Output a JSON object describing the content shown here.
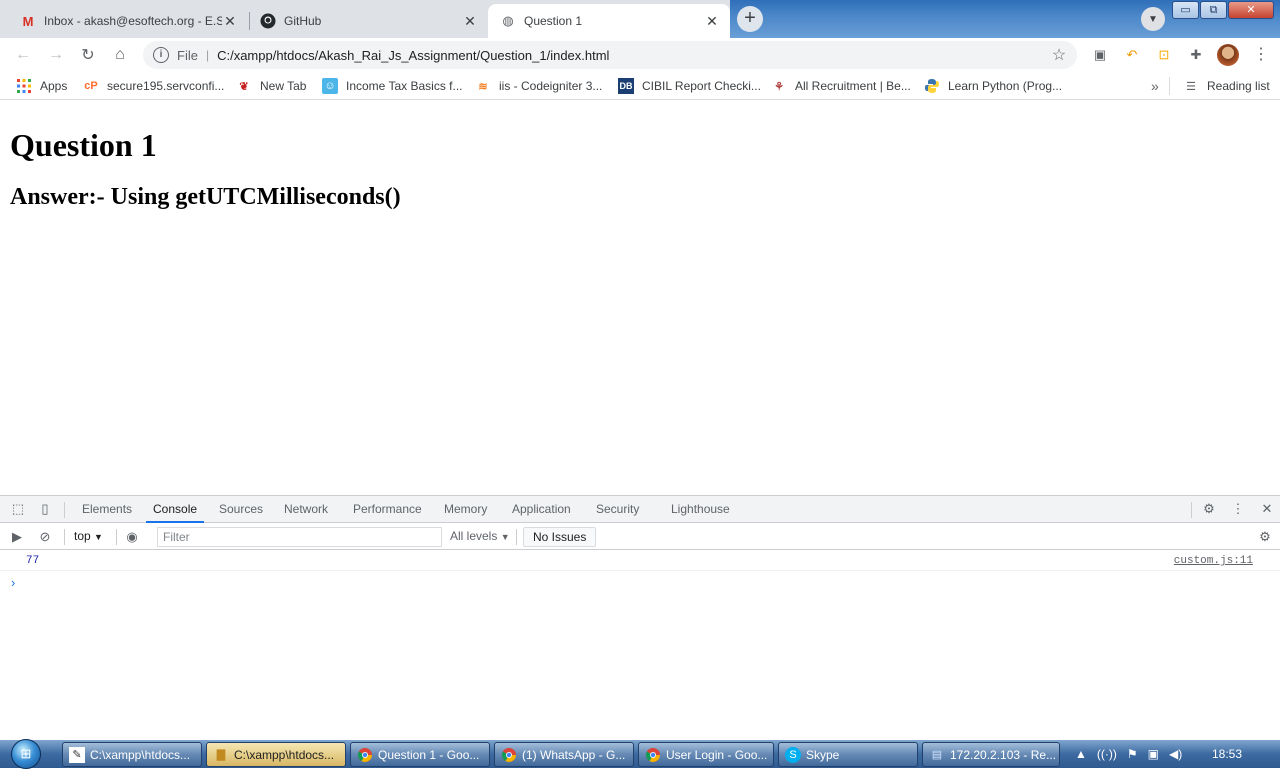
{
  "browser": {
    "tabs": [
      {
        "title": "Inbox - akash@esoftech.org - E.S",
        "icon": "gmail-icon"
      },
      {
        "title": "GitHub",
        "icon": "github-icon"
      },
      {
        "title": "Question 1",
        "icon": "globe-icon"
      }
    ],
    "window_controls": {
      "minimize": "▭",
      "restore": "⧉",
      "close": "✕"
    },
    "address": {
      "scheme_label": "File",
      "url": "C:/xampp/htdocs/Akash_Rai_Js_Assignment/Question_1/index.html"
    },
    "bookmarks": [
      {
        "label": "Apps",
        "icon": "apps-grid-icon"
      },
      {
        "label": "secure195.servconfi...",
        "icon": "cpanel-icon"
      },
      {
        "label": "New Tab",
        "icon": "newtab-icon"
      },
      {
        "label": "Income Tax Basics f...",
        "icon": "robot-icon"
      },
      {
        "label": "iis - Codeigniter 3...",
        "icon": "stackoverflow-icon"
      },
      {
        "label": "CIBIL Report Checki...",
        "icon": "db-icon"
      },
      {
        "label": "All Recruitment | Be...",
        "icon": "recruitment-icon"
      },
      {
        "label": "Learn Python (Prog...",
        "icon": "python-icon"
      }
    ],
    "reading_list": "Reading list"
  },
  "page": {
    "heading": "Question 1",
    "answer": "Answer:- Using getUTCMilliseconds()"
  },
  "devtools": {
    "tabs": [
      "Elements",
      "Console",
      "Sources",
      "Network",
      "Performance",
      "Memory",
      "Application",
      "Security",
      "Lighthouse"
    ],
    "active_tab": "Console",
    "context": "top",
    "filter_placeholder": "Filter",
    "levels": "All levels",
    "issues": "No Issues",
    "log": [
      {
        "value": "77",
        "source": "custom.js:11"
      }
    ]
  },
  "taskbar": {
    "items": [
      {
        "label": "C:\\xampp\\htdocs...",
        "icon": "notepad-icon"
      },
      {
        "label": "C:\\xampp\\htdocs...",
        "icon": "folder-icon"
      },
      {
        "label": "Question 1 - Goo...",
        "icon": "chrome-icon"
      },
      {
        "label": "(1) WhatsApp - G...",
        "icon": "chrome-icon"
      },
      {
        "label": "User Login - Goo...",
        "icon": "chrome-icon"
      },
      {
        "label": "Skype",
        "icon": "skype-icon"
      },
      {
        "label": "172.20.2.103 - Re...",
        "icon": "remote-desktop-icon"
      }
    ],
    "clock": "18:53"
  }
}
